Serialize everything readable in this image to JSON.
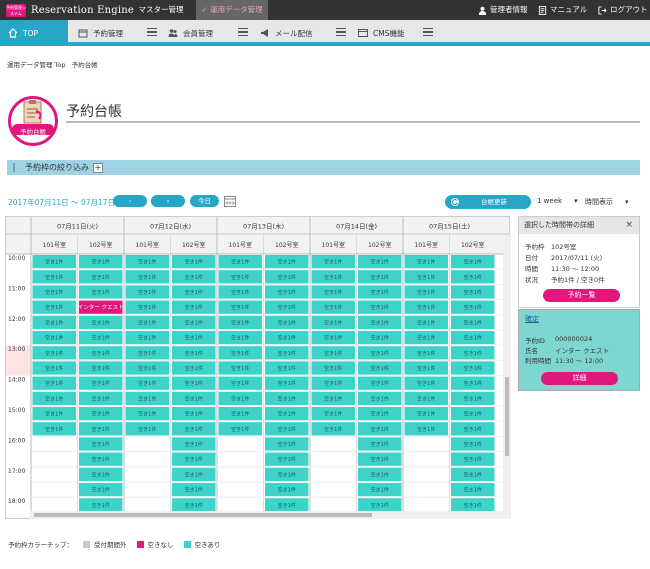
{
  "topbar": {
    "logo_small": "予約管理システム",
    "app_name": "Reservation Engine",
    "nav": [
      "マスター管理",
      "運用データ管理"
    ],
    "right": [
      "管理者情報",
      "マニュアル",
      "ログアウト"
    ]
  },
  "nav": {
    "items": [
      "TOP",
      "予約管理",
      "会員管理",
      "メール配信",
      "CMS機能"
    ]
  },
  "breadcrumb": [
    "運用データ管理 Top",
    "予約台帳"
  ],
  "page": {
    "icon_label": "予約台帳",
    "title": "予約台帳"
  },
  "filter": {
    "label": "予約枠の絞り込み",
    "toggle": "+"
  },
  "toolbar": {
    "range": "2017年07月11日 ～ 07月17日",
    "prev": "‹",
    "next": "›",
    "today": "今日",
    "update": "台帳更新",
    "week_select": "1 week",
    "display_select": "時間表示"
  },
  "calendar": {
    "dates": [
      "07月11日(火)",
      "07月12日(水)",
      "07月13日(木)",
      "07月14日(金)",
      "07月15日(土)"
    ],
    "rooms": [
      "101号室",
      "102号室"
    ],
    "time_labels": [
      {
        "label": "10:00",
        "row": 0
      },
      {
        "label": "11:00",
        "row": 2
      },
      {
        "label": "12:00",
        "row": 4
      },
      {
        "label": "13:00",
        "row": 6
      },
      {
        "label": "14:00",
        "row": 8
      },
      {
        "label": "15:00",
        "row": 10
      },
      {
        "label": "16:00",
        "row": 12
      },
      {
        "label": "17:00",
        "row": 14
      },
      {
        "label": "18:00",
        "row": 16
      }
    ],
    "slot_text": "空き1件",
    "booked_text": "インター クエスト",
    "booked_slot": {
      "date": 0,
      "room": 1,
      "row": 3
    },
    "highlight_rows": [
      6,
      7
    ],
    "available_rows_room101": 12,
    "available_rows_room102": 17
  },
  "detail": {
    "title": "選択した時間帯の詳細",
    "close": "×",
    "rows": [
      {
        "k": "予約枠",
        "v": "102号室"
      },
      {
        "k": "日付",
        "v": "2017/07/11 (火)"
      },
      {
        "k": "時間",
        "v": "11:30 ～ 12:00"
      },
      {
        "k": "状況",
        "v": "予約1件 / 空き0件"
      }
    ],
    "list_button": "予約一覧"
  },
  "booking": {
    "status": "確定",
    "rows": [
      {
        "k": "予約ID",
        "v": "000000024"
      },
      {
        "k": "氏名",
        "v": "インター クエスト"
      },
      {
        "k": "利用時間",
        "v": "11:30 ～ 12:00"
      }
    ],
    "detail_button": "詳細"
  },
  "legend": {
    "label": "予約枠カラーチップ：",
    "items": [
      {
        "label": "受付期間外",
        "color": "#c8c8c8"
      },
      {
        "label": "空きなし",
        "color": "#e0177c"
      },
      {
        "label": "空きあり",
        "color": "#3ed3c9"
      }
    ]
  },
  "colors": {
    "accent": "#27a6c7",
    "pink": "#e0177c",
    "slot": "#3ed3c9",
    "dark": "#333333"
  }
}
